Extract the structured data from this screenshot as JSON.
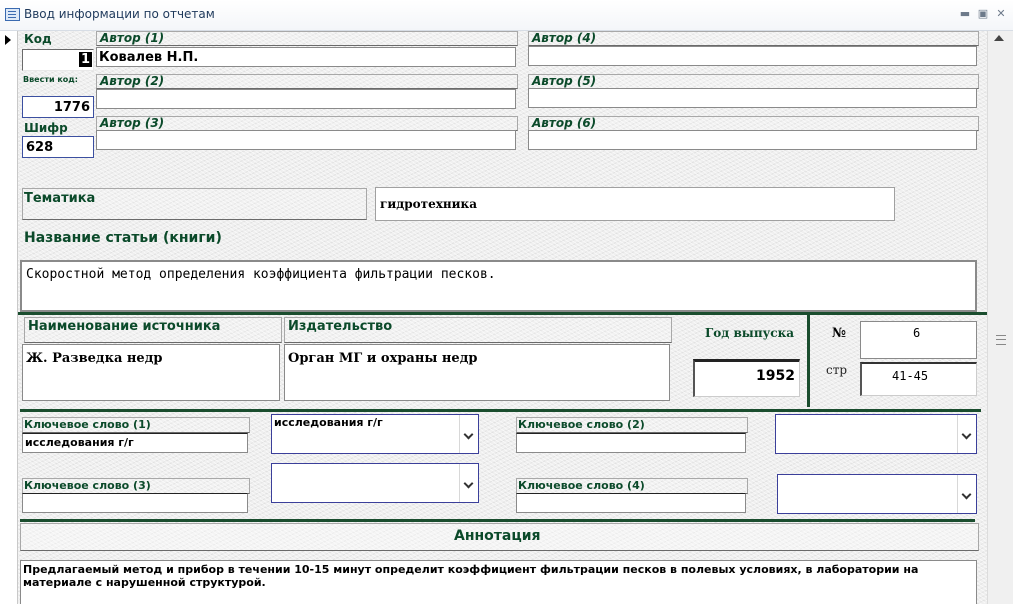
{
  "window": {
    "title": "Ввод информации по отчетам"
  },
  "record": {
    "code_label": "Код",
    "code_value": "1",
    "enter_code_label": "Ввести код:",
    "enter_code_value": "1776",
    "cipher_label": "Шифр",
    "cipher_value": "628"
  },
  "authors": [
    {
      "label": "Автор (1)",
      "value": "Ковалев Н.П."
    },
    {
      "label": "Автор (2)",
      "value": ""
    },
    {
      "label": "Автор (3)",
      "value": ""
    },
    {
      "label": "Автор (4)",
      "value": ""
    },
    {
      "label": "Автор (5)",
      "value": ""
    },
    {
      "label": "Автор (6)",
      "value": ""
    }
  ],
  "topic": {
    "label": "Тематика",
    "value": "гидротехника"
  },
  "title_field": {
    "label": "Название статьи (книги)",
    "value": "Скоростной метод определения коэффициента фильтрации песков."
  },
  "source": {
    "label": "Наименование источника",
    "value": "Ж. Разведка недр"
  },
  "publisher": {
    "label": "Издательство",
    "value": "Орган МГ и охраны недр"
  },
  "year": {
    "label": "Год выпуска",
    "value": "1952"
  },
  "number": {
    "label": "№",
    "value": "6"
  },
  "pages": {
    "label": "стр",
    "value": "41-45"
  },
  "keywords": [
    {
      "label": "Ключевое слово (1)",
      "value": "исследования г/г",
      "combo_value": "исследования г/г"
    },
    {
      "label": "Ключевое слово (2)",
      "value": "",
      "combo_value": ""
    },
    {
      "label": "Ключевое слово (3)",
      "value": "",
      "combo_value": ""
    },
    {
      "label": "Ключевое слово (4)",
      "value": "",
      "combo_value": ""
    }
  ],
  "annotation": {
    "label": "Аннотация",
    "value": "Предлагаемый метод и прибор в течении 10-15 минут определит коэффициент фильтрации песков в полевых условиях, в лаборатории на материале с нарушенной структурой."
  },
  "icons": [
    "form-icon",
    "minimize-icon",
    "restore-icon",
    "close-icon",
    "record-selector-icon",
    "chevron-down-icon",
    "scroll-up-icon"
  ]
}
